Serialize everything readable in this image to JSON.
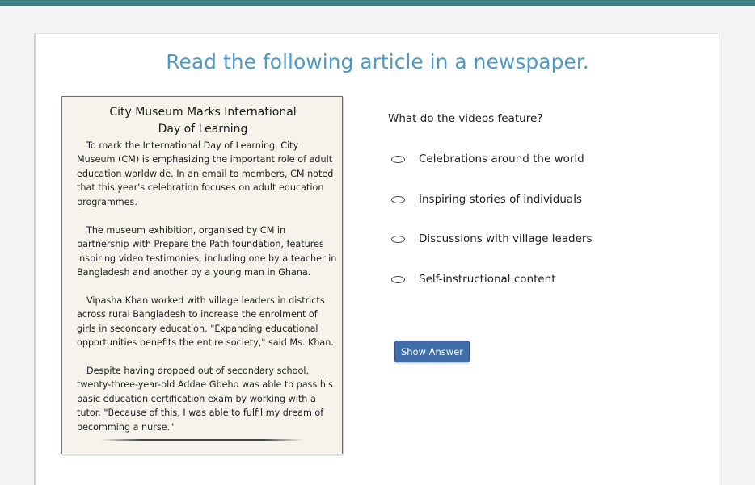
{
  "colors": {
    "topbar": "#3e7f82",
    "heading": "#4d9ac9",
    "button": "#3f6ea8",
    "article_bg": "#f6f3ec"
  },
  "heading": "Read the following article in a newspaper.",
  "article": {
    "title_lines": [
      "City Museum Marks International",
      "Day of Learning"
    ],
    "paragraphs": [
      [
        "To mark the International Day of Learning, City",
        "Museum (CM) is emphasizing the important role of adult",
        "education worldwide. In an email to members, CM noted",
        "that this year's celebration focuses on adult education",
        "programmes."
      ],
      [
        "The museum exhibition, organised by CM in",
        "partnership with Prepare the Path foundation, features",
        "inspiring video testimonies, including one by a teacher in",
        "Bangladesh and another by a young man in Ghana."
      ],
      [
        "Vipasha Khan worked with village leaders in districts",
        "across rural Bangladesh to increase the enrolment of",
        "girls in secondary education. \"Expanding educational",
        "opportunities benefits the entire society,\" said Ms. Khan."
      ],
      [
        "Despite having dropped out of secondary school,",
        "twenty-three-year-old Addae Gbeho was able to pass his",
        "basic education certification exam by working with a",
        "tutor. \"Because of this, I was able to fulfil my dream of",
        "becomming a nurse.\""
      ]
    ]
  },
  "question": "What do the videos feature?",
  "options": [
    "Celebrations around the world",
    "Inspiring stories of individuals",
    "Discussions with village leaders",
    "Self-instructional content"
  ],
  "show_answer_label": "Show Answer"
}
